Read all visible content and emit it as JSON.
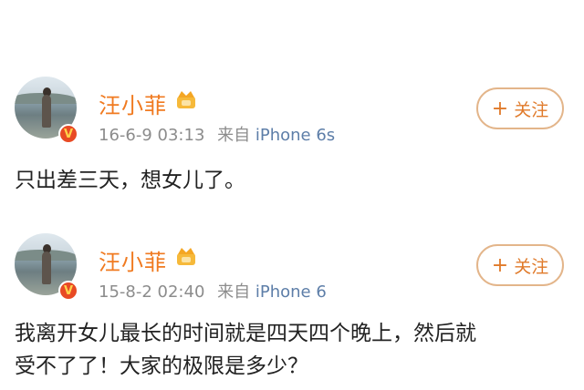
{
  "posts": [
    {
      "username": "汪小菲",
      "timestamp": "16-6-9 03:13",
      "source_prefix": "来自",
      "device": "iPhone 6s",
      "follow_label": "关注",
      "follow_symbol": "+",
      "text": "只出差三天，想女儿了。"
    },
    {
      "username": "汪小菲",
      "timestamp": "15-8-2 02:40",
      "source_prefix": "来自",
      "device": "iPhone 6",
      "follow_label": "关注",
      "follow_symbol": "+",
      "text_line1": "我离开女儿最长的时间就是四天四个晚上，然后就",
      "text_line2": "受不了了！大家的极限是多少？"
    }
  ],
  "colors": {
    "username": "#f07a20",
    "follow_border": "#e3b58a",
    "verified_badge": "#e84a24",
    "meta": "#8c8c8c"
  }
}
